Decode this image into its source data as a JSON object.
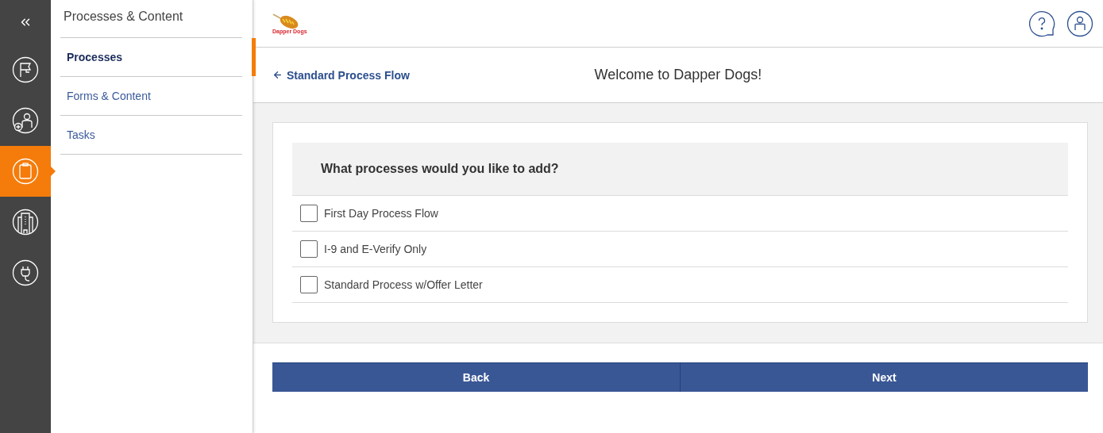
{
  "rail": {
    "items": [
      {
        "kind": "collapse",
        "selected": false
      },
      {
        "kind": "flag",
        "selected": false
      },
      {
        "kind": "person-add",
        "selected": false
      },
      {
        "kind": "clipboard",
        "selected": true
      },
      {
        "kind": "building",
        "selected": false
      },
      {
        "kind": "plug",
        "selected": false
      }
    ]
  },
  "subnav": {
    "title": "Processes & Content",
    "items": [
      {
        "label": "Processes",
        "selected": true
      },
      {
        "label": "Forms & Content",
        "selected": false
      },
      {
        "label": "Tasks",
        "selected": false
      }
    ]
  },
  "header": {
    "logo_text": "Dapper Dogs"
  },
  "subheader": {
    "back_link": "Standard Process Flow",
    "title": "Welcome to Dapper Dogs!"
  },
  "question": {
    "prompt": "What processes would you like to add?",
    "options": [
      {
        "label": "First Day Process Flow",
        "checked": false
      },
      {
        "label": "I-9 and E-Verify Only",
        "checked": false
      },
      {
        "label": "Standard Process w/Offer Letter",
        "checked": false
      }
    ]
  },
  "buttons": [
    "Back",
    "Next"
  ]
}
